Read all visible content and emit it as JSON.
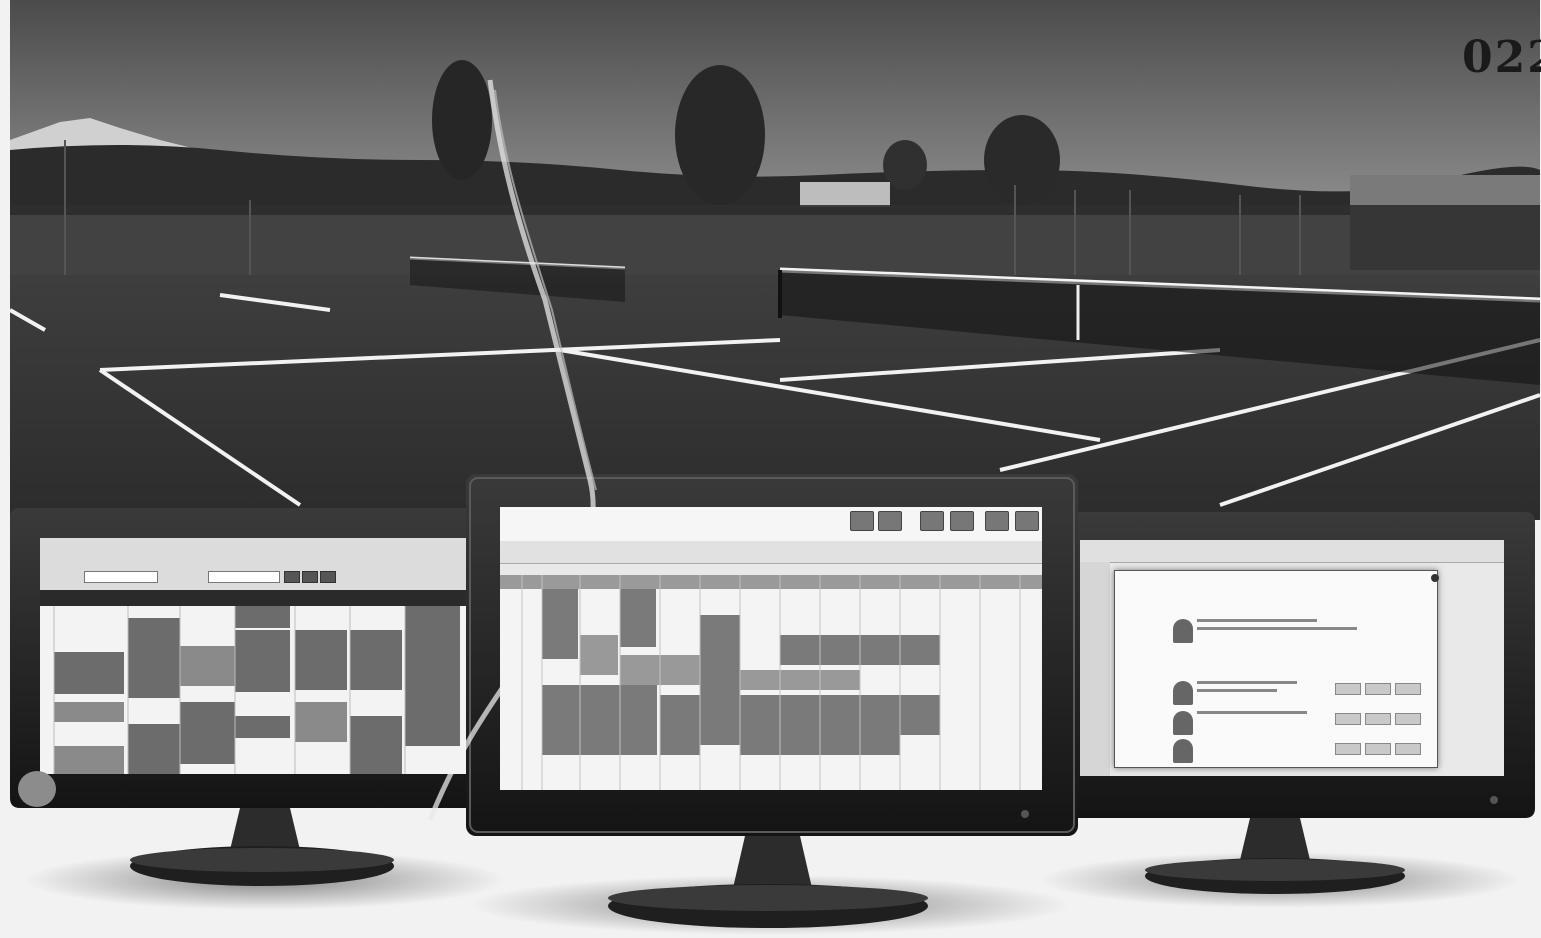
{
  "page": {
    "number": "022"
  },
  "monitors": {
    "left": {
      "icon": "monitor-icon"
    },
    "center": {
      "icon": "monitor-icon"
    },
    "right": {
      "icon": "monitor-icon"
    }
  },
  "colors": {
    "sky": "#5a5a5a",
    "court": "#3a3a3a",
    "court_lines": "#f2f2f2",
    "bezel": "#1e1e1e",
    "screen": "#e9e9e9"
  }
}
